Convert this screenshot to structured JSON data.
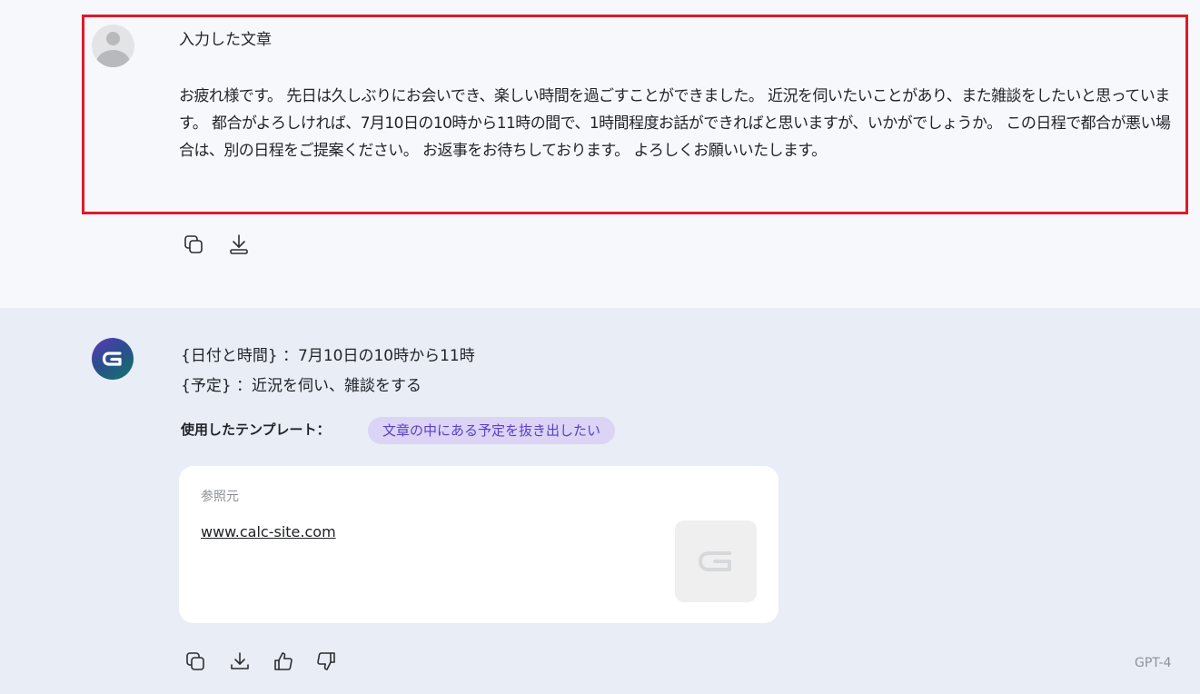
{
  "user_message": {
    "title": "入力した文章",
    "text": "お疲れ様です。 先日は久しぶりにお会いでき、楽しい時間を過ごすことができました。 近況を伺いたいことがあり、また雑談をしたいと思っています。 都合がよろしければ、7月10日の10時から11時の間で、1時間程度お話ができればと思いますが、いかがでしょうか。 この日程で都合が悪い場合は、別の日程をご提案ください。 お返事をお待ちしております。 よろしくお願いいたします。",
    "actions": [
      "copy-icon",
      "download-icon"
    ]
  },
  "assistant_message": {
    "lines": [
      "{日付と時間} ：7月10日の10時から11時",
      "{予定} ：近況を伺い、雑談をする"
    ],
    "template_label": "使用したテンプレート：",
    "template_name": "文章の中にある予定を抜き出したい",
    "reference": {
      "label": "参照元",
      "url": "www.calc-site.com"
    },
    "actions": [
      "copy-icon",
      "download-icon",
      "thumbs-up-icon",
      "thumbs-down-icon"
    ],
    "model": "GPT-4"
  },
  "colors": {
    "highlight_border": "#e0192a",
    "chip_background": "#dcd4f5",
    "chip_text": "#5b3ec6",
    "assistant_background": "#e9edf5"
  }
}
